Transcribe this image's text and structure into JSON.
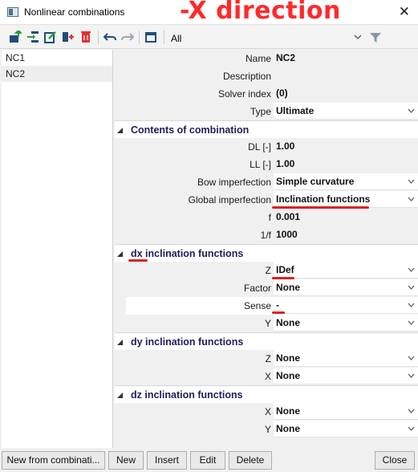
{
  "window": {
    "title": "Nonlinear combinations",
    "overlay_annotation": "-X direction",
    "close_glyph": "✕"
  },
  "toolbar": {
    "filter_value": "All",
    "icons": [
      "new-item-icon",
      "insert-icon",
      "edit-icon",
      "copy-icon",
      "delete-icon",
      "undo-icon",
      "redo-icon",
      "table-icon"
    ]
  },
  "list": {
    "items": [
      {
        "label": "NC1",
        "selected": false
      },
      {
        "label": "NC2",
        "selected": true
      }
    ]
  },
  "properties": {
    "name": {
      "label": "Name",
      "value": "NC2"
    },
    "description": {
      "label": "Description",
      "value": ""
    },
    "solver_index": {
      "label": "Solver index",
      "value": "(0)"
    },
    "type": {
      "label": "Type",
      "value": "Ultimate"
    }
  },
  "sections": {
    "contents": "Contents of combination",
    "dx": "dx inclination functions",
    "dy": "dy inclination functions",
    "dz": "dz inclination functions"
  },
  "contents": {
    "dl": {
      "label": "DL [-]",
      "value": "1.00"
    },
    "ll": {
      "label": "LL [-]",
      "value": "1.00"
    },
    "bow": {
      "label": "Bow imperfection",
      "value": "Simple curvature"
    },
    "global": {
      "label": "Global imperfection",
      "value": "Inclination functions"
    },
    "f": {
      "label": "f",
      "value": "0.001"
    },
    "one_over_f": {
      "label": "1/f",
      "value": "1000"
    }
  },
  "dx": {
    "z": {
      "label": "Z",
      "value": "IDef"
    },
    "factor": {
      "label": "Factor",
      "value": "None"
    },
    "sense": {
      "label": "Sense",
      "value": "-"
    },
    "y": {
      "label": "Y",
      "value": "None"
    }
  },
  "dy": {
    "z": {
      "label": "Z",
      "value": "None"
    },
    "x": {
      "label": "X",
      "value": "None"
    }
  },
  "dz": {
    "x": {
      "label": "X",
      "value": "None"
    },
    "y": {
      "label": "Y",
      "value": "None"
    }
  },
  "buttons": {
    "new_from_combination": "New from combinati...",
    "new": "New",
    "insert": "Insert",
    "edit": "Edit",
    "delete": "Delete",
    "close": "Close"
  },
  "colors": {
    "annotation_red": "#ff2a2a",
    "section_title": "#1e1e5a",
    "toolbar_icon_blue": "#1f4e79",
    "toolbar_icon_red": "#e03030"
  }
}
